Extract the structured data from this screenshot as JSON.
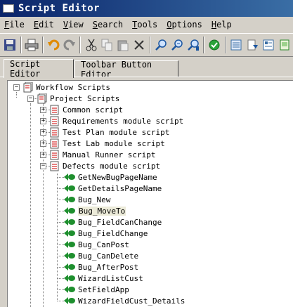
{
  "window": {
    "title": "Script Editor"
  },
  "menu": [
    {
      "u": "F",
      "rest": "ile"
    },
    {
      "u": "E",
      "rest": "dit"
    },
    {
      "u": "V",
      "rest": "iew"
    },
    {
      "u": "S",
      "rest": "earch"
    },
    {
      "u": "T",
      "rest": "ools"
    },
    {
      "u": "O",
      "rest": "ptions"
    },
    {
      "u": "H",
      "rest": "elp"
    }
  ],
  "toolbar_icons": [
    "save-icon",
    "print-icon",
    "undo-icon",
    "redo-icon",
    "cut-icon",
    "copy-icon",
    "paste-icon",
    "delete-icon",
    "find-icon",
    "find-next-icon",
    "replace-icon",
    "syntax-check-icon",
    "list-icon",
    "import-icon",
    "properties-icon",
    "page-icon"
  ],
  "tabs": [
    "Script Editor",
    "Toolbar Button Editor"
  ],
  "tree": {
    "root": "Workflow Scripts",
    "project": "Project Scripts",
    "modules": [
      "Common script",
      "Requirements module script",
      "Test Plan module script",
      "Test Lab module script",
      "Manual Runner script",
      "Defects module script"
    ],
    "functions": [
      "GetNewBugPageName",
      "GetDetailsPageName",
      "Bug_New",
      "Bug_MoveTo",
      "Bug_FieldCanChange",
      "Bug_FieldChange",
      "Bug_CanPost",
      "Bug_CanDelete",
      "Bug_AfterPost",
      "WizardListCust",
      "SetFieldApp",
      "WizardFieldCust_Details"
    ],
    "selected": "Bug_MoveTo"
  }
}
